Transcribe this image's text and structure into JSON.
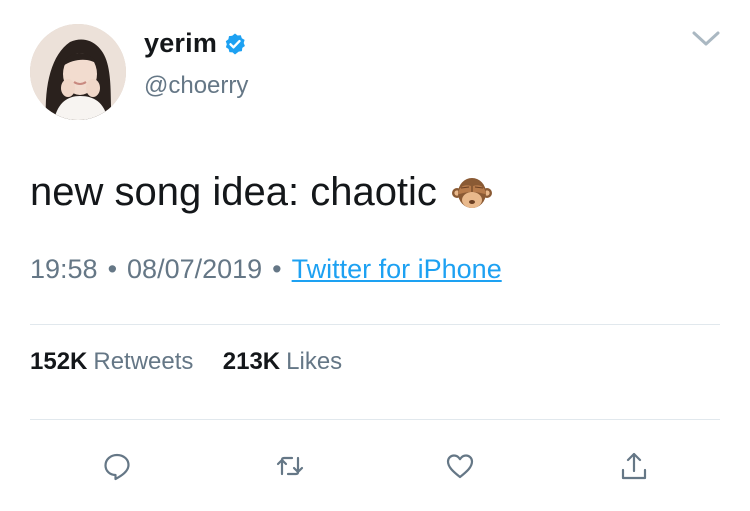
{
  "user": {
    "display_name": "yerim",
    "handle": "@choerry",
    "verified": true
  },
  "tweet": {
    "text": "new song idea: chaotic",
    "emoji_icon": "see-no-evil-monkey-emoji"
  },
  "meta": {
    "time": "19:58",
    "separator": "•",
    "date": "08/07/2019",
    "source": "Twitter for iPhone"
  },
  "stats": {
    "retweets_count": "152K",
    "retweets_label": "Retweets",
    "likes_count": "213K",
    "likes_label": "Likes"
  },
  "actions": [
    "reply-icon",
    "retweet-icon",
    "like-icon",
    "share-icon"
  ],
  "colors": {
    "accent": "#1da1f2",
    "secondary_text": "#657786",
    "divider": "#e1e8ed"
  }
}
